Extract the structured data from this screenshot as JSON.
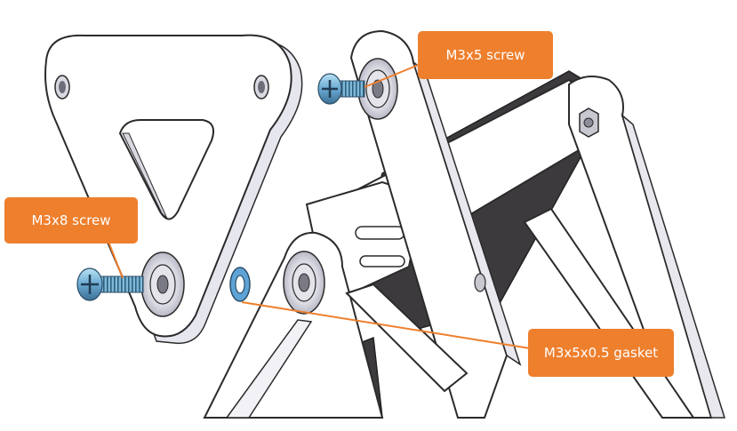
{
  "colors": {
    "callout": "#ee7f2d",
    "leader": "#ee7f2d",
    "part_outline": "#2b2b2b",
    "part_fill": "#ffffff",
    "dark_panel": "#3d3a3e",
    "screw_blue": "#7fc1e6",
    "washer_blue": "#5ea3d6"
  },
  "callouts": {
    "m3x5": "M3x5 screw",
    "m3x8": "M3x8 screw",
    "gasket": "M3x5x0.5 gasket"
  }
}
